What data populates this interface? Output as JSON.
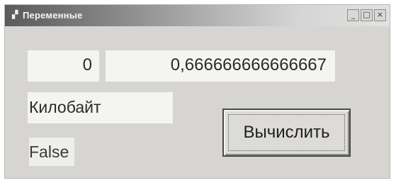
{
  "window": {
    "title": "Переменные",
    "controls": {
      "minimize": "_",
      "maximize": "□",
      "close": "×"
    }
  },
  "fields": {
    "integer_value": "0",
    "double_value": "0,666666666666667",
    "unit_value": "Килобайт"
  },
  "labels": {
    "bool_value": "False"
  },
  "buttons": {
    "calculate": "Вычислить"
  },
  "icons": {
    "window_icon": "form-icon"
  }
}
